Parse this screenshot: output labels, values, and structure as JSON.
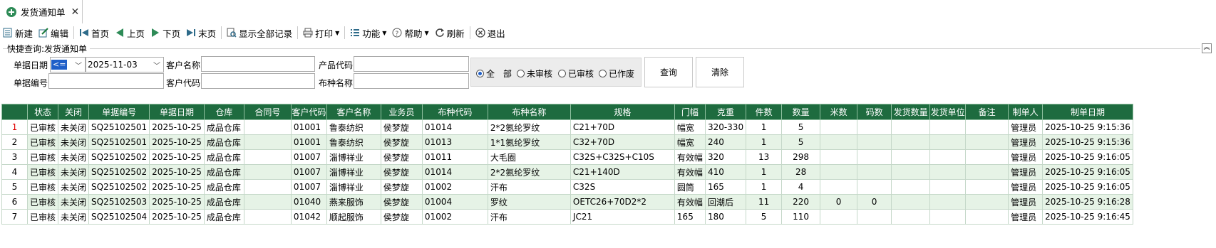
{
  "tab": {
    "title": "发货通知单",
    "close": "✕"
  },
  "toolbar": {
    "new": "新建",
    "edit": "编辑",
    "first": "首页",
    "prev": "上页",
    "next": "下页",
    "last": "末页",
    "show_all": "显示全部记录",
    "print": "打印",
    "func": "功能",
    "help": "帮助",
    "refresh": "刷新",
    "exit": "退出"
  },
  "query": {
    "title": "快捷查询:发货通知单",
    "date_label": "单据日期",
    "date_op": "<=",
    "date_value": "2025-11-03",
    "customer_name_label": "客户名称",
    "product_code_label": "产品代码",
    "doc_no_label": "单据编号",
    "customer_code_label": "客户代码",
    "fabric_name_label": "布种名称",
    "radios": [
      "全　部",
      "未审核",
      "已审核",
      "已作废"
    ],
    "radio_selected": 0,
    "search_btn": "查询",
    "clear_btn": "清除"
  },
  "grid": {
    "columns": [
      "",
      "状态",
      "关闭",
      "单据编号",
      "单据日期",
      "仓库",
      "合同号",
      "客户代码",
      "客户名称",
      "业务员",
      "布种代码",
      "布种名称",
      "规格",
      "门幅",
      "克重",
      "件数",
      "数量",
      "米数",
      "码数",
      "发货数量",
      "发货单位",
      "备注",
      "制单人",
      "制单日期"
    ],
    "rows": [
      [
        "1",
        "已审核",
        "未关闭",
        "SQ25102501",
        "2025-10-25",
        "成品仓库",
        "",
        "01001",
        "鲁泰纺织",
        "侯梦旋",
        "01014",
        "2*2氨纶罗纹",
        "C21+70D",
        "幅宽",
        "320-330",
        "1",
        "5",
        "",
        "",
        "",
        "",
        "",
        "管理员",
        "2025-10-25 9:15:36"
      ],
      [
        "2",
        "已审核",
        "未关闭",
        "SQ25102501",
        "2025-10-25",
        "成品仓库",
        "",
        "01001",
        "鲁泰纺织",
        "侯梦旋",
        "01013",
        "1*1氨纶罗纹",
        "C32+70D",
        "幅宽",
        "240",
        "1",
        "5",
        "",
        "",
        "",
        "",
        "",
        "管理员",
        "2025-10-25 9:15:36"
      ],
      [
        "3",
        "已审核",
        "未关闭",
        "SQ25102502",
        "2025-10-25",
        "成品仓库",
        "",
        "01007",
        "淄博祥业",
        "侯梦旋",
        "01011",
        "大毛圈",
        "C32S+C32S+C10S",
        "有效幅",
        "320",
        "13",
        "298",
        "",
        "",
        "",
        "",
        "",
        "管理员",
        "2025-10-25 9:16:05"
      ],
      [
        "4",
        "已审核",
        "未关闭",
        "SQ25102502",
        "2025-10-25",
        "成品仓库",
        "",
        "01007",
        "淄博祥业",
        "侯梦旋",
        "01014",
        "2*2氨纶罗纹",
        "C21+140D",
        "有效幅",
        "410",
        "1",
        "28",
        "",
        "",
        "",
        "",
        "",
        "管理员",
        "2025-10-25 9:16:05"
      ],
      [
        "5",
        "已审核",
        "未关闭",
        "SQ25102502",
        "2025-10-25",
        "成品仓库",
        "",
        "01007",
        "淄博祥业",
        "侯梦旋",
        "01002",
        "汗布",
        "C32S",
        "圆筒",
        "165",
        "1",
        "4",
        "",
        "",
        "",
        "",
        "",
        "管理员",
        "2025-10-25 9:16:05"
      ],
      [
        "6",
        "已审核",
        "未关闭",
        "SQ25102503",
        "2025-10-25",
        "成品仓库",
        "",
        "01040",
        "燕来服饰",
        "侯梦旋",
        "01004",
        "罗纹",
        "OETC26+70D2*2",
        "有效幅",
        "回潮后",
        "11",
        "220",
        "0",
        "0",
        "",
        "",
        "",
        "管理员",
        "2025-10-25 9:16:28"
      ],
      [
        "7",
        "已审核",
        "未关闭",
        "SQ25102504",
        "2025-10-25",
        "成品仓库",
        "",
        "01042",
        "顺起服饰",
        "侯梦旋",
        "01002",
        "汗布",
        "JC21",
        "165",
        "180",
        "5",
        "110",
        "",
        "",
        "",
        "",
        "",
        "管理员",
        "2025-10-25 9:16:45"
      ]
    ]
  },
  "colors": {
    "header_bg": "#1e6b3f",
    "row_alt": "#e6f3e6",
    "accent": "#1f5fc8",
    "selected_row_number": "#e00000"
  }
}
